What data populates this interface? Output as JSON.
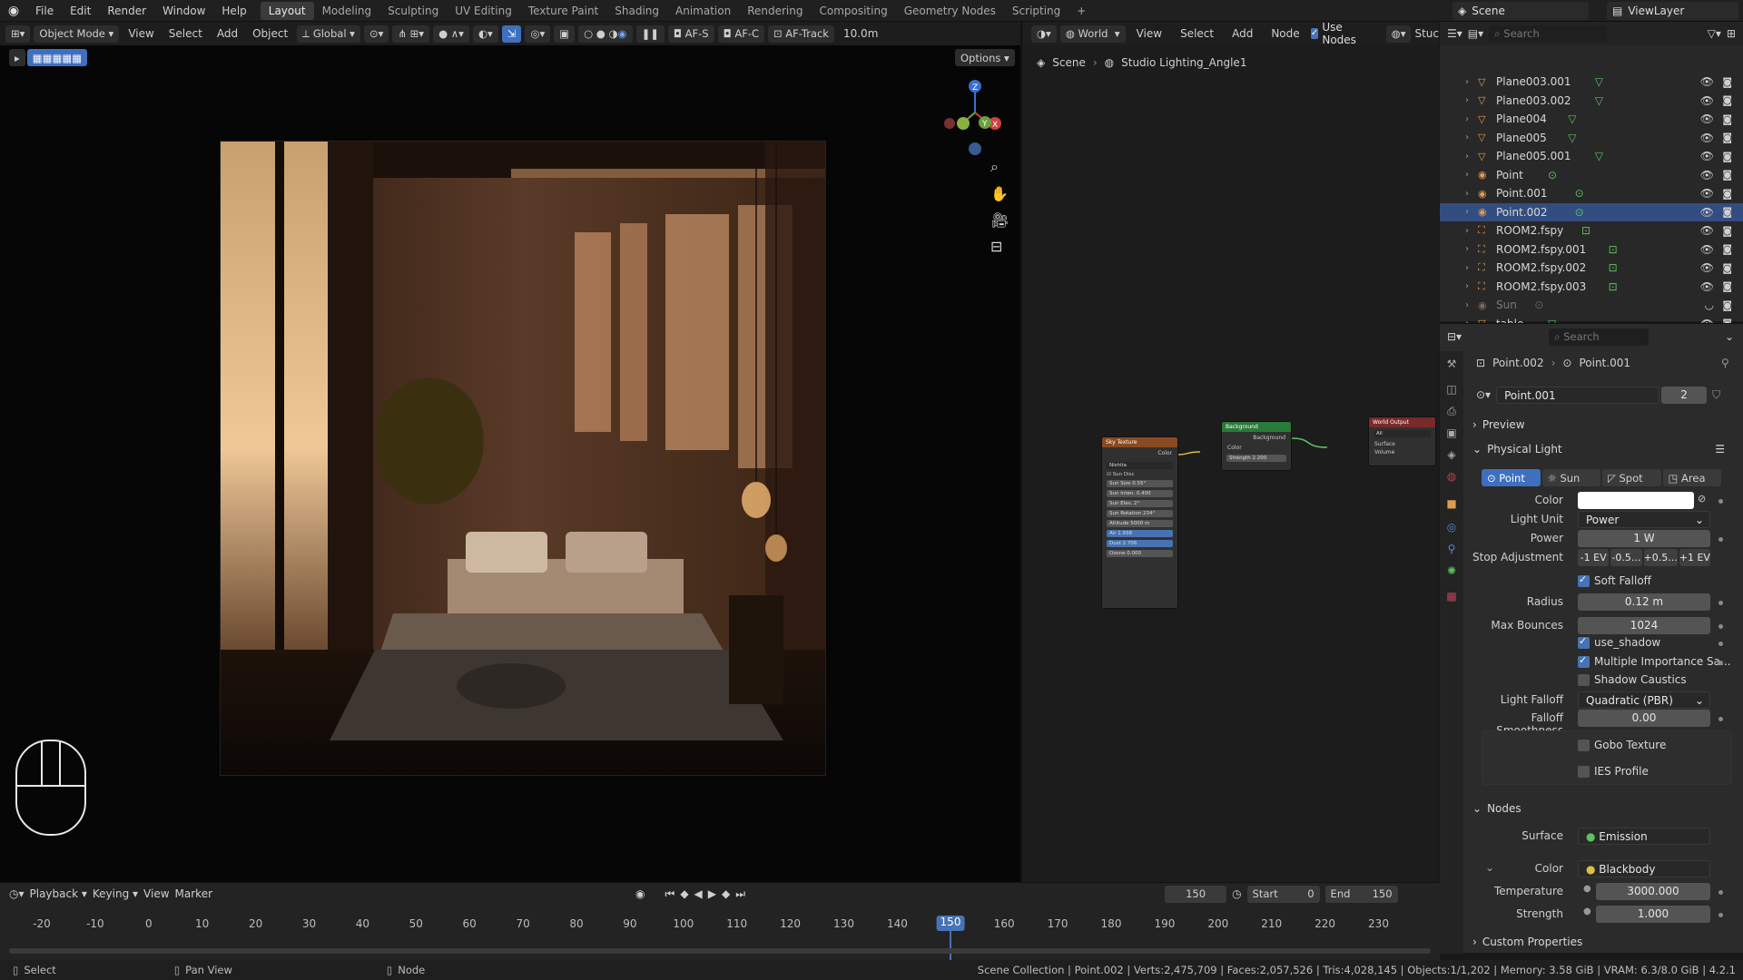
{
  "topbar": {
    "menus": [
      "File",
      "Edit",
      "Render",
      "Window",
      "Help"
    ],
    "workspaces": [
      "Layout",
      "Modeling",
      "Sculpting",
      "UV Editing",
      "Texture Paint",
      "Shading",
      "Animation",
      "Rendering",
      "Compositing",
      "Geometry Nodes",
      "Scripting"
    ],
    "active_workspace": "Layout",
    "scene": "Scene",
    "view_layer": "ViewLayer"
  },
  "viewport": {
    "mode": "Object Mode",
    "menus": [
      "View",
      "Select",
      "Add",
      "Object"
    ],
    "transform": "Global",
    "af_s": "AF-S",
    "af_c": "AF-C",
    "af_track": "AF-Track",
    "distance": "10.0m",
    "options": "Options"
  },
  "node_editor": {
    "world": "World",
    "menus": [
      "View",
      "Select",
      "Add",
      "Node"
    ],
    "use_nodes": "Use Nodes",
    "stuck_label": "Stuc",
    "breadcrumb": [
      "Scene",
      "Studio Lighting_Angle1"
    ],
    "nodes": {
      "sky": {
        "title": "Sky Texture",
        "out": "Color",
        "type": "Nishita",
        "sun_disc": "Sun Disc",
        "rows": [
          "Sun Size 0.55°",
          "Sun Inten. 0.400",
          "Sun Elev. 2°",
          "Sun Rotation 234°",
          "Altitude 5000 m",
          "Air 1.938",
          "Dust 2.706",
          "Ozone 0.000"
        ]
      },
      "bg": {
        "title": "Background",
        "out": "Background",
        "color": "Color",
        "strength": "Strength 2.200"
      },
      "wo": {
        "title": "World Output",
        "target": "All",
        "surface": "Surface",
        "volume": "Volume"
      }
    }
  },
  "outliner": {
    "search_placeholder": "Search",
    "items": [
      {
        "name": "Plane003.001",
        "type": "mesh"
      },
      {
        "name": "Plane003.002",
        "type": "mesh"
      },
      {
        "name": "Plane004",
        "type": "mesh"
      },
      {
        "name": "Plane005",
        "type": "mesh"
      },
      {
        "name": "Plane005.001",
        "type": "mesh"
      },
      {
        "name": "Point",
        "type": "light"
      },
      {
        "name": "Point.001",
        "type": "light"
      },
      {
        "name": "Point.002",
        "type": "light",
        "selected": true
      },
      {
        "name": "ROOM2.fspy",
        "type": "camera"
      },
      {
        "name": "ROOM2.fspy.001",
        "type": "camera"
      },
      {
        "name": "ROOM2.fspy.002",
        "type": "camera"
      },
      {
        "name": "ROOM2.fspy.003",
        "type": "camera"
      },
      {
        "name": "Sun",
        "type": "light",
        "dim": true
      },
      {
        "name": "table",
        "type": "mesh"
      }
    ]
  },
  "properties": {
    "search_placeholder": "Search",
    "breadcrumb": [
      "Point.002",
      "Point.001"
    ],
    "datablock": "Point.001",
    "users": "2",
    "preview": "Preview",
    "physical_light": "Physical Light",
    "light_types": [
      "Point",
      "Sun",
      "Spot",
      "Area"
    ],
    "color_label": "Color",
    "light_unit_label": "Light Unit",
    "light_unit": "Power",
    "power_label": "Power",
    "power": "1 W",
    "stop_label": "Stop Adjustment",
    "stops": [
      "-1 EV",
      "-0.5...",
      "+0.5...",
      "+1 EV"
    ],
    "soft_falloff": "Soft Falloff",
    "radius_label": "Radius",
    "radius": "0.12 m",
    "max_bounces_label": "Max Bounces",
    "max_bounces": "1024",
    "use_shadow": "use_shadow",
    "mis": "Multiple Importance Sa...",
    "shadow_caustics": "Shadow Caustics",
    "falloff_label": "Light Falloff",
    "falloff": "Quadratic (PBR)",
    "smooth_label": "Falloff Smoothness",
    "smooth": "0.00",
    "gobo": "Gobo Texture",
    "ies": "IES Profile",
    "nodes": "Nodes",
    "surface_label": "Surface",
    "surface": "Emission",
    "ncolor_label": "Color",
    "ncolor": "Blackbody",
    "temp_label": "Temperature",
    "temp": "3000.000",
    "strength_label": "Strength",
    "strength": "1.000",
    "custom": "Custom Properties"
  },
  "timeline": {
    "menus": [
      "Playback",
      "Keying",
      "View",
      "Marker"
    ],
    "current_frame": "150",
    "start_label": "Start",
    "start": "0",
    "end_label": "End",
    "end": "150",
    "ticks": [
      "-20",
      "-10",
      "0",
      "10",
      "20",
      "30",
      "40",
      "50",
      "60",
      "70",
      "80",
      "90",
      "100",
      "110",
      "120",
      "130",
      "140",
      "150",
      "160",
      "170",
      "180",
      "190",
      "200",
      "210",
      "220",
      "230"
    ]
  },
  "status": {
    "select": "Select",
    "pan": "Pan View",
    "node": "Node",
    "stats": "Scene Collection | Point.002 | Verts:2,475,709 | Faces:2,057,526 | Tris:4,028,145 | Objects:1/1,202 | Memory: 3.58 GiB | VRAM: 6.3/8.0 GiB | 4.2.1"
  },
  "colors": {
    "accent": "#4772b3",
    "light_color": "#ffffff",
    "mesh_icon": "#e09a50",
    "data_icon": "#5fbf5f"
  }
}
